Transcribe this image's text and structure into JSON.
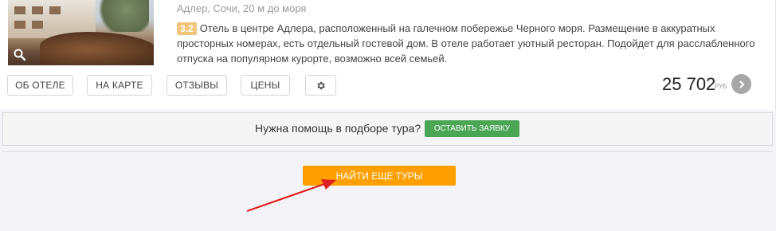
{
  "hotel": {
    "location": "Адлер, Сочи, 20 м до моря",
    "rating": "3.2",
    "description": "Отель в центре Адлера, расположенный на галечном побережье Черного моря. Размещение в аккуратных просторных номерах, есть отдельный гостевой дом. В отеле работает уютный ресторан. Подойдет для расслабленного отпуска на популярном курорте, возможно всей семьей.",
    "buttons": {
      "about": "ОБ ОТЕЛЕ",
      "map": "НА КАРТЕ",
      "reviews": "ОТЗЫВЫ",
      "prices": "ЦЕНЫ"
    },
    "price": "25 702",
    "currency": "РУБ"
  },
  "help": {
    "text": "Нужна помощь в подборе тура?",
    "button": "ОСТАВИТЬ ЗАЯВКУ"
  },
  "more_button": "НАЙТИ ЕЩЕ ТУРЫ",
  "colors": {
    "accent_orange": "#ffa000",
    "green": "#4aa654",
    "rating_badge": "#f1c57a",
    "annotation_arrow": "#e02020"
  }
}
